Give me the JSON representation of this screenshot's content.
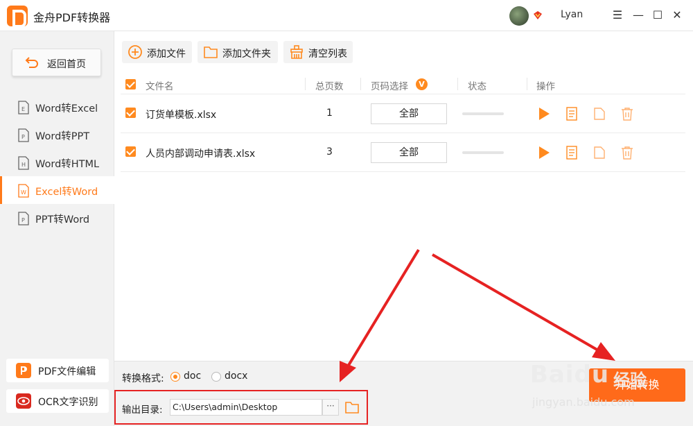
{
  "titlebar": {
    "app_title": "金舟PDF转换器",
    "username": "Lyan",
    "minimize": "☰",
    "min": "—",
    "max": "☐",
    "close": "✕"
  },
  "sidebar": {
    "home_label": "返回首页",
    "items": [
      {
        "label": "Word转Excel",
        "letter": "E"
      },
      {
        "label": "Word转PPT",
        "letter": "P"
      },
      {
        "label": "Word转HTML",
        "letter": "H"
      },
      {
        "label": "Excel转Word",
        "letter": "W"
      },
      {
        "label": "PPT转Word",
        "letter": "P"
      }
    ],
    "active_index": 3,
    "tools": [
      {
        "label": "PDF文件编辑"
      },
      {
        "label": "OCR文字识别"
      }
    ]
  },
  "toolbar": {
    "add_file": "添加文件",
    "add_folder": "添加文件夹",
    "clear_list": "清空列表"
  },
  "table": {
    "headers": {
      "filename": "文件名",
      "pages": "总页数",
      "page_select": "页码选择",
      "page_select_badge": "V",
      "status": "状态",
      "actions": "操作"
    },
    "rows": [
      {
        "filename": "订货单模板.xlsx",
        "pages": "1",
        "page_select": "全部",
        "progress": 0
      },
      {
        "filename": "人员内部调动申请表.xlsx",
        "pages": "3",
        "page_select": "全部",
        "progress": 0
      }
    ]
  },
  "bottom": {
    "format_label": "转换格式:",
    "formats": [
      "doc",
      "docx"
    ],
    "selected_format": "doc",
    "output_label": "输出目录:",
    "output_path": "C:\\Users\\admin\\Desktop",
    "browse_label": "···",
    "start_label": "开始转换"
  },
  "watermark": {
    "main": "Baidu",
    "sub": "经验",
    "url": "jingyan.baidu.com"
  },
  "colors": {
    "accent": "#ff7a1a",
    "annotation": "#e62222"
  }
}
